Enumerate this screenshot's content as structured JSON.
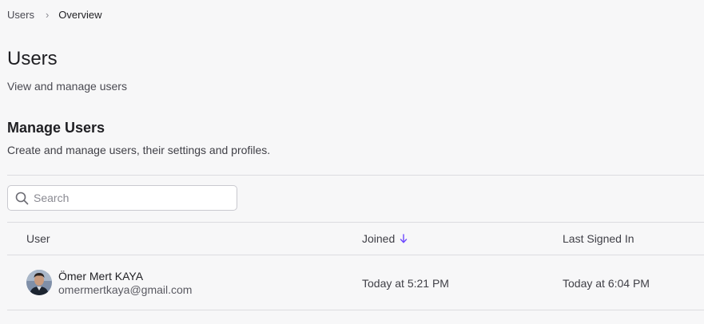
{
  "breadcrumb": {
    "items": [
      "Users",
      "Overview"
    ],
    "separator": "›"
  },
  "header": {
    "title": "Users",
    "subtitle": "View and manage users"
  },
  "section": {
    "title": "Manage Users",
    "description": "Create and manage users, their settings and profiles."
  },
  "search": {
    "placeholder": "Search",
    "value": ""
  },
  "table": {
    "columns": {
      "user": "User",
      "joined": "Joined",
      "last_signed_in": "Last Signed In"
    },
    "sort": {
      "column": "joined",
      "direction": "descending",
      "icon": "arrow-down-icon"
    },
    "rows": [
      {
        "name": "Ömer Mert KAYA",
        "email": "omermertkaya@gmail.com",
        "joined": "Today at 5:21 PM",
        "last_signed_in": "Today at 6:04 PM",
        "avatar": "user-photo"
      }
    ]
  },
  "colors": {
    "background": "#f7f7f8",
    "accent": "#6c47ff",
    "divider": "#dcdce0",
    "text_primary": "#1f1f23",
    "text_secondary": "#5a5a62"
  }
}
